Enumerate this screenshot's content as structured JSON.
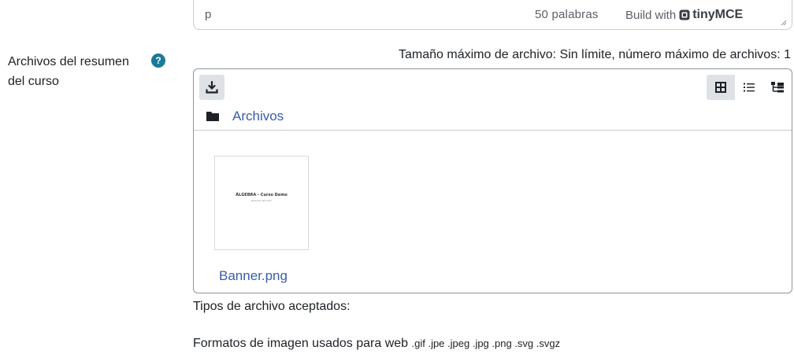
{
  "editor_status": {
    "path": "p",
    "word_count": "50 palabras",
    "build_with": "Build with",
    "brand": "tinyMCE"
  },
  "field": {
    "label": "Archivos del resumen del curso",
    "max_size": "Tamaño máximo de archivo: Sin límite, número máximo de archivos: 1"
  },
  "filemanager": {
    "breadcrumb": "Archivos",
    "files": [
      {
        "name": "Banner.png",
        "thumb_title": "ÁLGEBRA - Curso Demo",
        "thumb_subtitle": "Resumen del curso"
      }
    ]
  },
  "accepted": {
    "label": "Tipos de archivo aceptados:",
    "formats_label": "Formatos de imagen usados para web",
    "extensions": ".gif .jpe .jpeg .jpg .png .svg .svgz"
  },
  "colors": {
    "link": "#3a5bab",
    "help_icon": "#1a7a9a",
    "button_bg": "#dee2e6"
  }
}
